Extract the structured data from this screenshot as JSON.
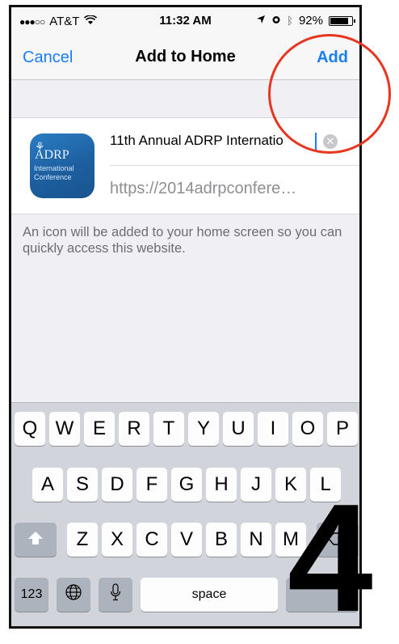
{
  "status_bar": {
    "signal": "●●●○○",
    "carrier": "AT&T",
    "time": "11:32 AM",
    "battery_text": "92%",
    "icons": [
      "wifi-icon",
      "location-icon",
      "alarm-icon",
      "bluetooth-icon",
      "battery-icon"
    ]
  },
  "navbar": {
    "cancel_label": "Cancel",
    "title": "Add to Home",
    "add_label": "Add"
  },
  "bookmark": {
    "icon_text_top": "ADRP",
    "icon_text_small": "International Conference",
    "title_value": "11th Annual ADRP Internatio",
    "url_value": "https://2014adrpconfere…"
  },
  "note": {
    "text": "An icon will be added to your home screen so you can quickly access this website."
  },
  "keyboard": {
    "row1": [
      "Q",
      "W",
      "E",
      "R",
      "T",
      "Y",
      "U",
      "I",
      "O",
      "P"
    ],
    "row2": [
      "A",
      "S",
      "D",
      "F",
      "G",
      "H",
      "J",
      "K",
      "L"
    ],
    "row3": [
      "Z",
      "X",
      "C",
      "V",
      "B",
      "N",
      "M"
    ],
    "numbers_label": "123",
    "space_label": "space"
  },
  "annotation": {
    "step_number": "4",
    "circle_color": "#e8351f"
  },
  "colors": {
    "accent": "#1a7efb",
    "background": "#efeff4",
    "keyboard": "#d1d5db"
  }
}
